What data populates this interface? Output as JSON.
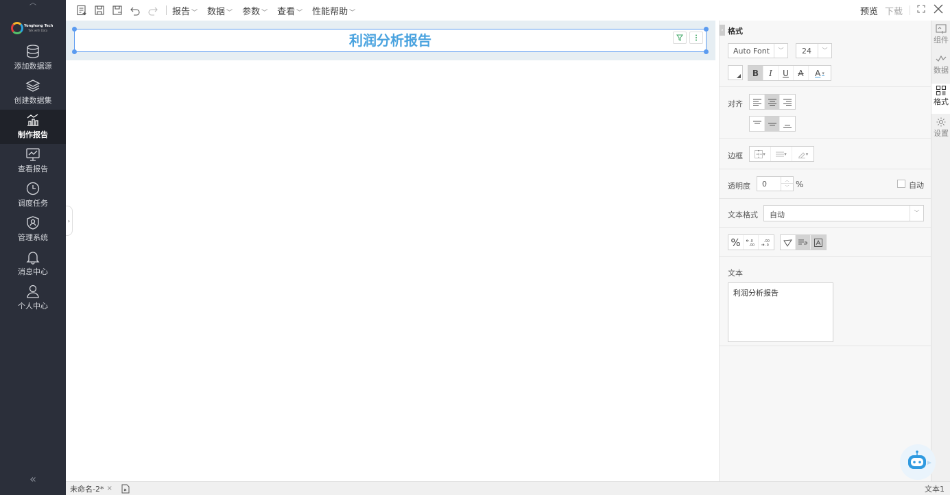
{
  "nav": {
    "items": [
      {
        "label": "添加数据源",
        "icon": "database-icon"
      },
      {
        "label": "创建数据集",
        "icon": "layers-icon"
      },
      {
        "label": "制作报告",
        "icon": "chart-icon"
      },
      {
        "label": "查看报告",
        "icon": "monitor-chart-icon"
      },
      {
        "label": "调度任务",
        "icon": "clock-icon"
      },
      {
        "label": "管理系统",
        "icon": "shield-user-icon"
      },
      {
        "label": "消息中心",
        "icon": "bell-icon"
      },
      {
        "label": "个人中心",
        "icon": "user-icon"
      }
    ],
    "active": "制作报告",
    "logo_text": "Yonghong Tech",
    "logo_sub": "Talk with Data",
    "collapse_glyph": "«"
  },
  "toolbar": {
    "menus": [
      "报告",
      "数据",
      "参数",
      "查看",
      "性能帮助"
    ],
    "preview": "预览",
    "download": "下载"
  },
  "canvas": {
    "title_text": "利润分析报告"
  },
  "panel": {
    "title": "格式",
    "font_family": "Auto Font",
    "font_size": "24",
    "style_buttons": [
      "B",
      "I",
      "U",
      "A",
      "A"
    ],
    "align_label": "对齐",
    "border_label": "边框",
    "opacity_label": "透明度",
    "opacity_value": "0",
    "opacity_unit": "%",
    "auto_label": "自动",
    "text_format_label": "文本格式",
    "text_format_value": "自动",
    "text_label": "文本",
    "text_value": "利润分析报告",
    "percent_glyph": "%"
  },
  "rail": {
    "items": [
      "组件",
      "数据",
      "格式",
      "设置"
    ],
    "active": "格式"
  },
  "tabbar": {
    "tab_label": "未命名-2*",
    "close_glyph": "×",
    "status": "文本1"
  },
  "colors": {
    "accent": "#4aa3df",
    "selection": "#5b9bf0",
    "nav_bg": "#2b2f3a"
  }
}
